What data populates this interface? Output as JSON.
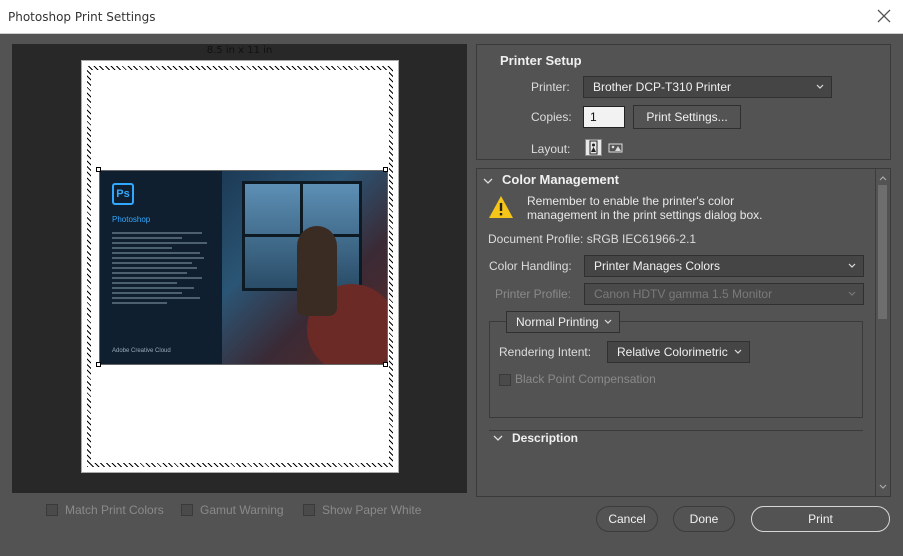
{
  "window": {
    "title": "Photoshop Print Settings"
  },
  "preview": {
    "paper_size": "8.5 in x 11 in",
    "art": {
      "app_name": "Photoshop",
      "logo_text": "Ps",
      "footer": "Adobe Creative Cloud"
    }
  },
  "printer_setup": {
    "title": "Printer Setup",
    "printer_label": "Printer:",
    "printer_value": "Brother DCP-T310 Printer",
    "copies_label": "Copies:",
    "copies_value": "1",
    "print_settings_button": "Print Settings...",
    "layout_label": "Layout:"
  },
  "color_management": {
    "title": "Color Management",
    "note_line1": "Remember to enable the printer's color",
    "note_line2": "management in the print settings dialog box.",
    "document_profile": "Document Profile: sRGB IEC61966-2.1",
    "color_handling_label": "Color Handling:",
    "color_handling_value": "Printer Manages Colors",
    "printer_profile_label": "Printer Profile:",
    "printer_profile_value": "Canon HDTV gamma 1.5 Monitor",
    "printing_mode": "Normal Printing",
    "rendering_intent_label": "Rendering Intent:",
    "rendering_intent_value": "Relative Colorimetric",
    "black_point_label": "Black Point Compensation",
    "description_title": "Description"
  },
  "preview_options": {
    "match_print_colors": "Match Print Colors",
    "gamut_warning": "Gamut Warning",
    "show_paper_white": "Show Paper White"
  },
  "buttons": {
    "cancel": "Cancel",
    "done": "Done",
    "print": "Print"
  },
  "colors": {
    "accent": "#31a8ff",
    "panel": "#535353",
    "preview_bg": "#282828",
    "warning": "#f5c518"
  }
}
